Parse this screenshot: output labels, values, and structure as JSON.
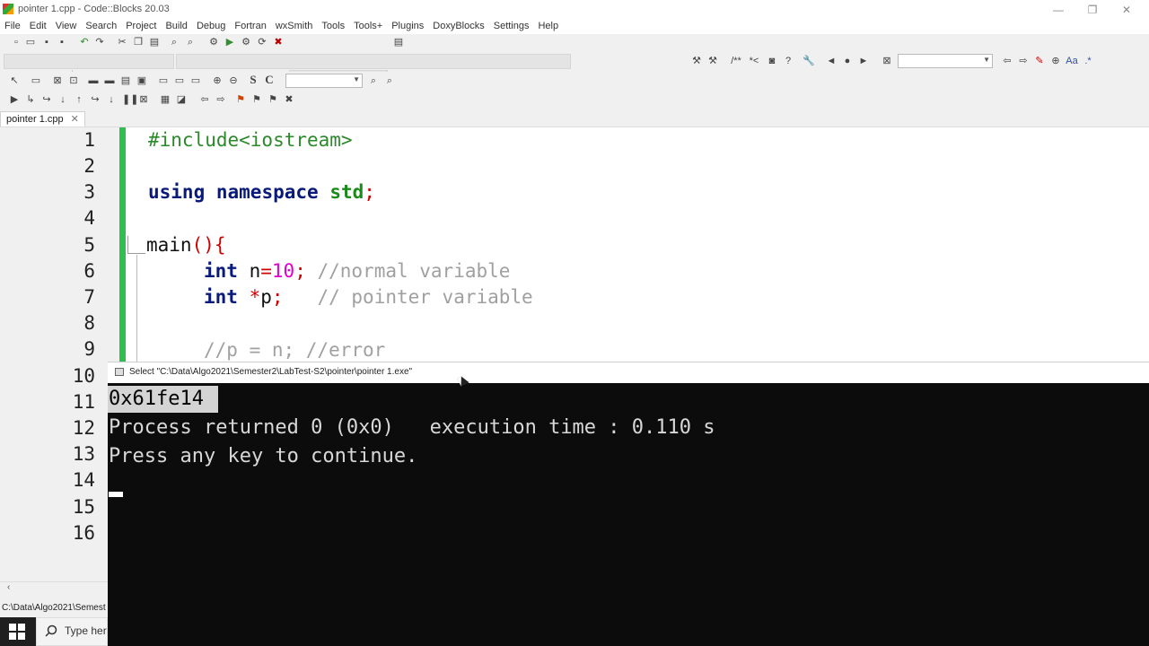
{
  "window": {
    "title": "pointer 1.cpp - Code::Blocks 20.03",
    "minimize": "—",
    "maximize": "❐",
    "close": "✕"
  },
  "menu": [
    "File",
    "Edit",
    "View",
    "Search",
    "Project",
    "Build",
    "Debug",
    "Fortran",
    "wxSmith",
    "Tools",
    "Tools+",
    "Plugins",
    "DoxyBlocks",
    "Settings",
    "Help"
  ],
  "toolbar": {
    "text_s": "S",
    "text_c": "C",
    "comment_block": "/**",
    "comment_line": "*<",
    "regex_btn": ".*",
    "match_case": "Aa"
  },
  "editor": {
    "tab_label": "pointer 1.cpp",
    "tab_close": "✕",
    "line_numbers": [
      "1",
      "2",
      "3",
      "4",
      "5",
      "6",
      "7",
      "8",
      "9",
      "10",
      "11",
      "12",
      "13",
      "14",
      "15",
      "16"
    ],
    "code": {
      "l1": "#include<iostream>",
      "l3_kw1": "using",
      "l3_kw2": "namespace",
      "l3_std": "std",
      "l3_semi": ";",
      "l5_fn": "main",
      "l5_paren": "()",
      "l5_brace": "{",
      "l6_type": "int",
      "l6_var": " n",
      "l6_eq": "=",
      "l6_num": "10",
      "l6_semi": ";",
      "l6_comment": " //normal variable",
      "l7_type": "int",
      "l7_star": " *",
      "l7_var": "p",
      "l7_semi": ";",
      "l7_comment": "   // pointer variable",
      "l9_comment": "//p = n; //error"
    }
  },
  "console": {
    "title": "Select \"C:\\Data\\Algo2021\\Semester2\\LabTest-S2\\pointer\\pointer 1.exe\"",
    "output": "0x61fe14",
    "process_line": "Process returned 0 (0x0)   execution time : 0.110 s",
    "press_line": "Press any key to continue."
  },
  "statusbar": {
    "path": "C:\\Data\\Algo2021\\Semest"
  },
  "taskbar": {
    "search_placeholder": "Type her"
  },
  "colors": {
    "change_bar": "#2ebf4f",
    "keyword": "#0a1a7a",
    "preprocessor": "#2a8a2a",
    "number": "#e000d0",
    "operator": "#d00000",
    "comment": "#a0a0a0"
  }
}
